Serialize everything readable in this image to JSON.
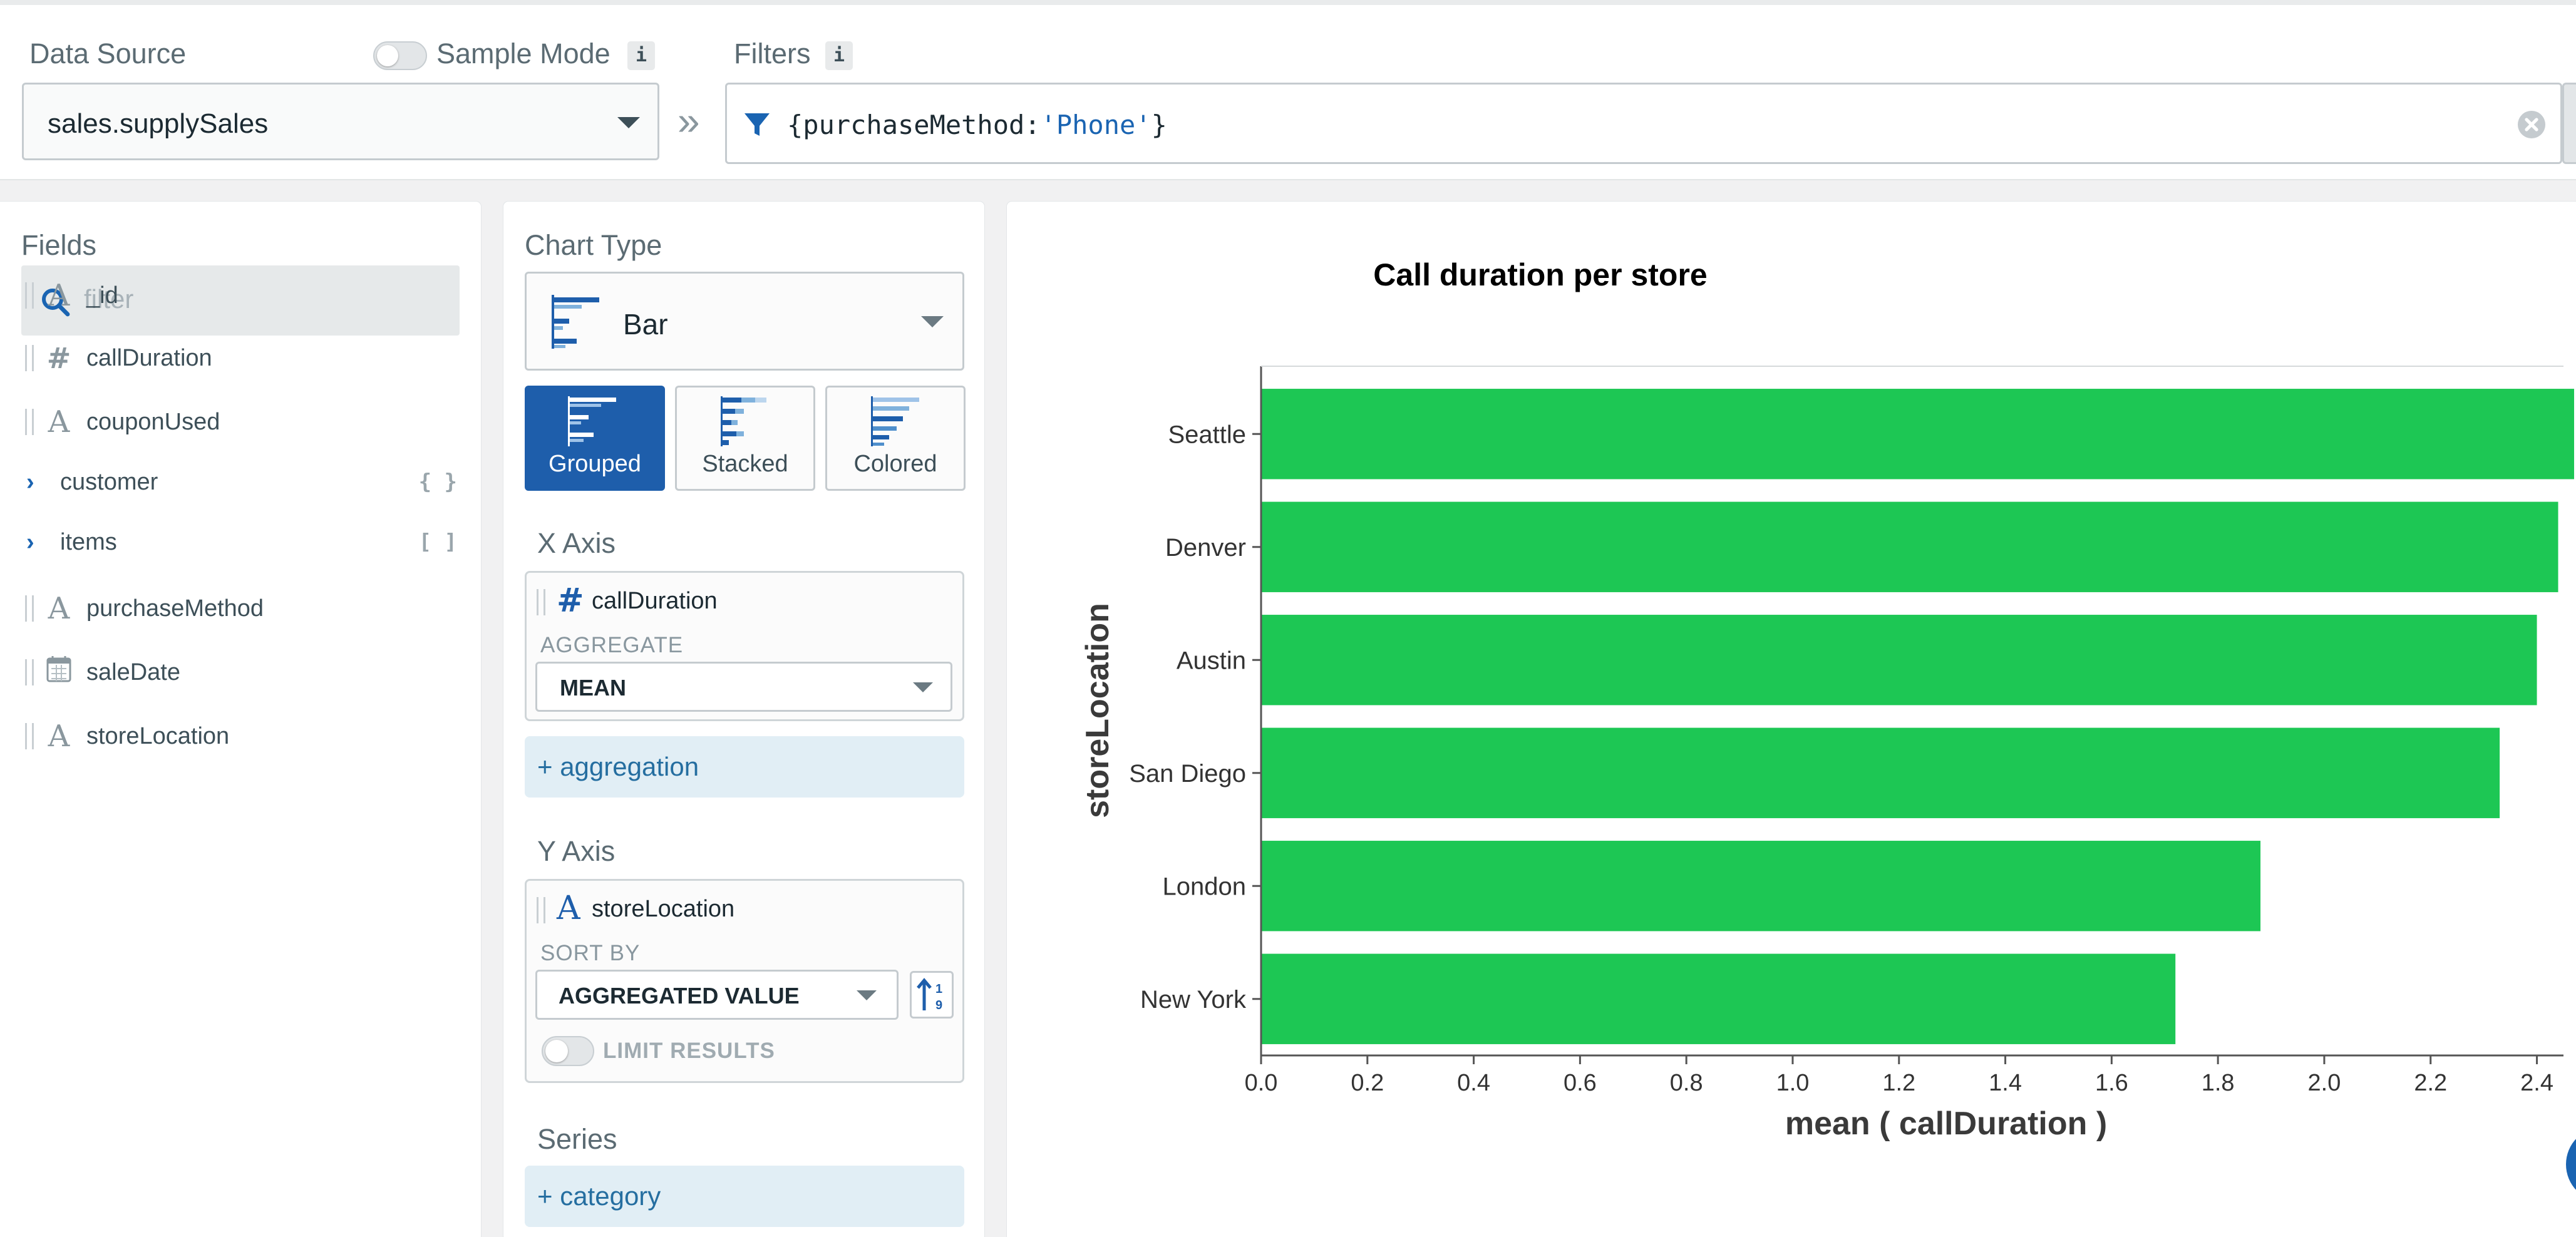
{
  "topbar": {
    "data_source_label": "Data Source",
    "sample_mode_label": "Sample Mode",
    "info_glyph": "i",
    "data_source_value": "sales.supplySales",
    "collapse_glyph": "»",
    "filters_label": "Filters",
    "filter_prefix": "{purchaseMethod:",
    "filter_string": "'Phone'",
    "filter_suffix": "}",
    "filter_string_color": "#1a64b2"
  },
  "fields": {
    "title": "Fields",
    "search_placeholder": "filter",
    "items": [
      {
        "name": "_id",
        "type": "string-icon",
        "glyph": "A"
      },
      {
        "name": "callDuration",
        "type": "number-icon",
        "glyph": "#"
      },
      {
        "name": "couponUsed",
        "type": "string-icon",
        "glyph": "A"
      },
      {
        "name": "customer",
        "type": "object",
        "badge": "{ }"
      },
      {
        "name": "items",
        "type": "array",
        "badge": "[ ]"
      },
      {
        "name": "purchaseMethod",
        "type": "string-icon",
        "glyph": "A"
      },
      {
        "name": "saleDate",
        "type": "date-icon",
        "glyph": ""
      },
      {
        "name": "storeLocation",
        "type": "string-icon",
        "glyph": "A"
      }
    ]
  },
  "encode": {
    "chart_type_label": "Chart Type",
    "chart_type_value": "Bar",
    "subtypes": [
      "Grouped",
      "Stacked",
      "Colored"
    ],
    "x_axis_label": "X Axis",
    "x_field": "callDuration",
    "x_glyph": "#",
    "aggregate_label": "AGGREGATE",
    "aggregate_value": "MEAN",
    "add_aggregation": "+ aggregation",
    "y_axis_label": "Y Axis",
    "y_field": "storeLocation",
    "y_glyph": "A",
    "sort_by_label": "SORT BY",
    "sort_by_value": "AGGREGATED VALUE",
    "limit_results_label": "LIMIT RESULTS",
    "series_label": "Series",
    "add_category": "+ category"
  },
  "colors": {
    "accent": "#1e5eab",
    "bar": "#1dc754",
    "link": "#256ea0"
  },
  "chart_data": {
    "type": "bar",
    "orientation": "horizontal",
    "title": "Call duration per store",
    "xlabel": "mean ( callDuration )",
    "ylabel": "storeLocation",
    "categories": [
      "Seattle",
      "Denver",
      "Austin",
      "San Diego",
      "London",
      "New York"
    ],
    "values": [
      2.47,
      2.44,
      2.4,
      2.33,
      1.88,
      1.72
    ],
    "xlim": [
      0,
      2.45
    ],
    "xticks": [
      "0.0",
      "0.2",
      "0.4",
      "0.6",
      "0.8",
      "1.0",
      "1.2",
      "1.4",
      "1.6",
      "1.8",
      "2.0",
      "2.2",
      "2.4"
    ],
    "color": "#1dc754",
    "grid": false
  }
}
